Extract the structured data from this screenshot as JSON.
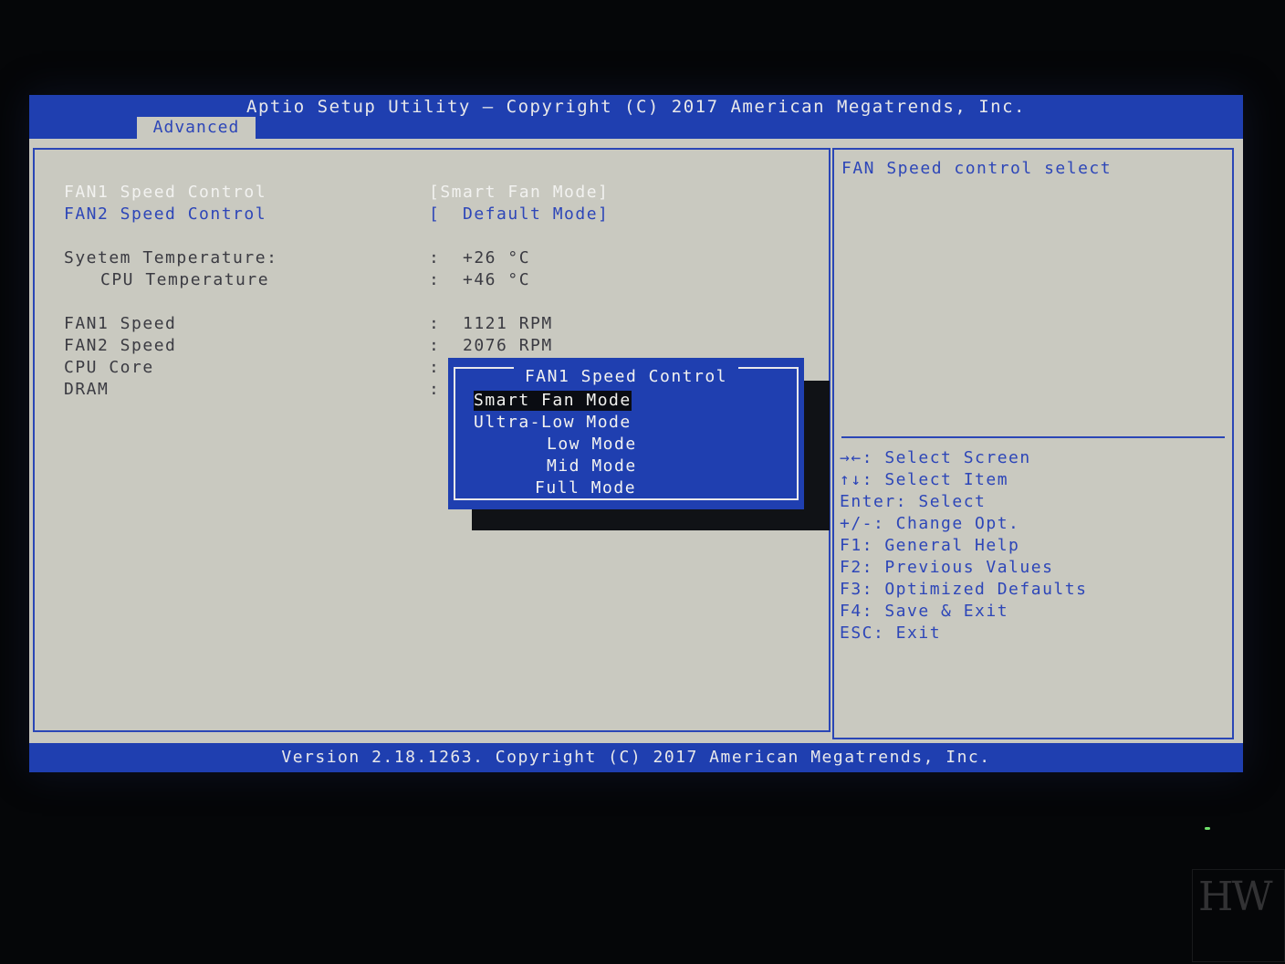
{
  "header": {
    "title": "Aptio Setup Utility – Copyright (C) 2017 American Megatrends, Inc.",
    "active_tab": "Advanced"
  },
  "main": {
    "items": [
      {
        "label": "FAN1 Speed Control",
        "value": "[Smart Fan Mode]"
      },
      {
        "label": "FAN2 Speed Control",
        "value": "[  Default Mode]"
      },
      {
        "label": "Syetem Temperature:",
        "value": ":  +26 °C"
      },
      {
        "label": "CPU Temperature",
        "value": ":  +46 °C"
      },
      {
        "label": "FAN1 Speed",
        "value": ":  1121 RPM"
      },
      {
        "label": "FAN2 Speed",
        "value": ":  2076 RPM"
      },
      {
        "label": "CPU Core",
        "value": ":"
      },
      {
        "label": "DRAM",
        "value": ":"
      }
    ]
  },
  "popup": {
    "title": "FAN1 Speed Control",
    "options": [
      "Smart Fan Mode",
      "Ultra-Low Mode",
      "Low Mode",
      "Mid Mode",
      "Full Mode"
    ],
    "selected": "Smart Fan Mode"
  },
  "help": {
    "description": "FAN Speed control select",
    "keys": [
      "→←: Select Screen",
      "↑↓: Select Item",
      "Enter: Select",
      "+/-: Change Opt.",
      "F1: General Help",
      "F2: Previous Values",
      "F3: Optimized Defaults",
      "F4: Save & Exit",
      "ESC: Exit"
    ]
  },
  "footer": {
    "version": "Version 2.18.1263. Copyright (C) 2017 American Megatrends, Inc."
  },
  "colors": {
    "bios_blue": "#1f3fb0",
    "panel_gray": "#c9c9c0",
    "highlight_text": "#f2f2f0",
    "link_blue": "#2d46b8"
  }
}
